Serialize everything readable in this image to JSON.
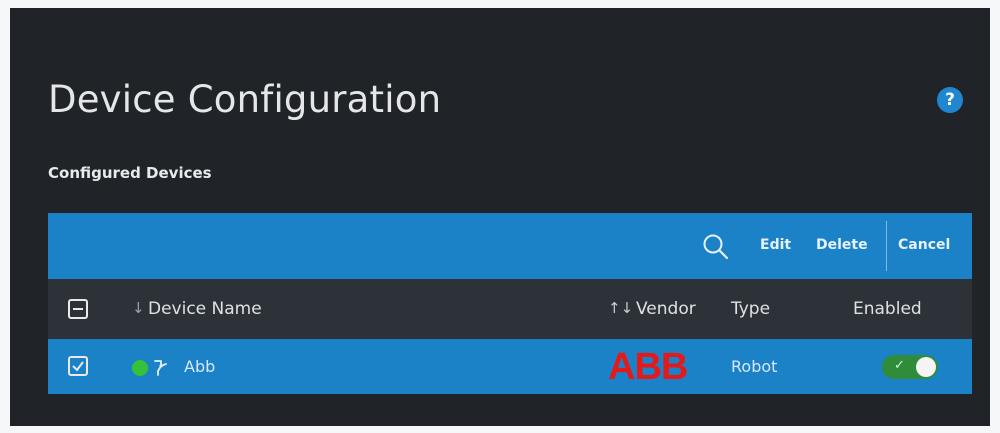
{
  "page": {
    "title": "Device Configuration",
    "help_icon": "?",
    "subtitle": "Configured Devices"
  },
  "toolbar": {
    "search_icon": "search-icon",
    "edit_label": "Edit",
    "delete_label": "Delete",
    "cancel_label": "Cancel"
  },
  "table": {
    "headers": {
      "device_name": "Device Name",
      "device_name_sort": "↓",
      "vendor": "Vendor",
      "vendor_sort": "↑↓",
      "type": "Type",
      "enabled": "Enabled"
    },
    "rows": [
      {
        "checked": true,
        "status": "online",
        "icon": "robot-arm-icon",
        "name": "Abb",
        "vendor_logo": "ABB",
        "type": "Robot",
        "enabled": true
      }
    ]
  },
  "colors": {
    "panel_bg": "#202428",
    "accent_blue": "#1c82c7",
    "status_green": "#35c23a",
    "toggle_green": "#2e8c3a",
    "abb_red": "#e41a1a"
  }
}
